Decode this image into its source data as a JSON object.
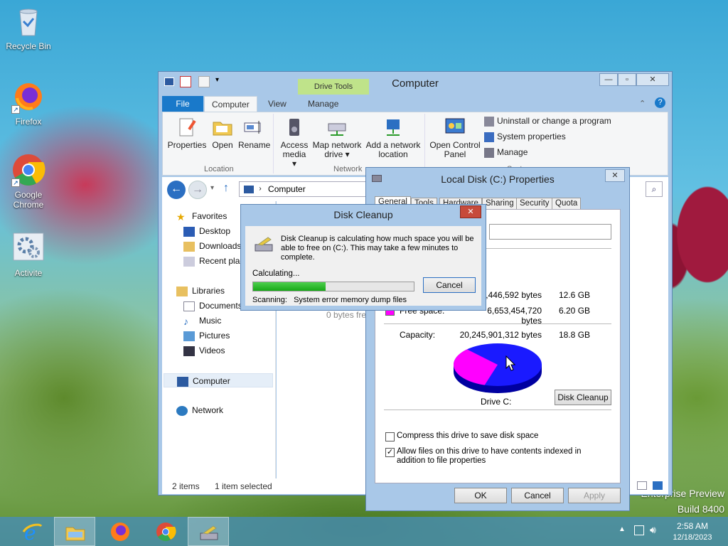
{
  "desktop": {
    "icons": [
      {
        "name": "recycle-bin",
        "label": "Recycle Bin"
      },
      {
        "name": "firefox",
        "label": "Firefox"
      },
      {
        "name": "google-chrome",
        "label": "Google Chrome"
      },
      {
        "name": "activite",
        "label": "Activite"
      }
    ],
    "watermark": {
      "line1": "Enterprise Preview",
      "line2": "Build 8400"
    }
  },
  "explorer": {
    "title": "Computer",
    "contextual_group": "Drive Tools",
    "tabs": [
      "File",
      "Computer",
      "View",
      "Manage"
    ],
    "ribbon": {
      "properties": "Properties",
      "open": "Open",
      "rename": "Rename",
      "access_media": "Access media",
      "map_network_drive": "Map network drive",
      "add_network_location": "Add a network location",
      "open_control_panel": "Open Control Panel",
      "uninstall": "Uninstall or change a program",
      "system_properties": "System properties",
      "manage": "Manage",
      "group_location": "Location",
      "group_network": "Network",
      "group_system": "System"
    },
    "address": "Computer",
    "nav": {
      "favorites": "Favorites",
      "desktop": "Desktop",
      "downloads": "Downloads",
      "recent": "Recent places",
      "libraries": "Libraries",
      "documents": "Documents",
      "music": "Music",
      "pictures": "Pictures",
      "videos": "Videos",
      "computer": "Computer",
      "network": "Network"
    },
    "content_partial": "0 bytes free",
    "status_items": "2 items",
    "status_selected": "1 item selected"
  },
  "props": {
    "title": "Local Disk (C:) Properties",
    "tabs": [
      "General",
      "Tools",
      "Hardware",
      "Sharing",
      "Security",
      "Quota"
    ],
    "used": {
      "bytes": "12,446,592 bytes",
      "size": "12.6 GB"
    },
    "free": {
      "label": "Free space:",
      "bytes": "6,653,454,720 bytes",
      "size": "6.20 GB"
    },
    "capacity": {
      "label": "Capacity:",
      "bytes": "20,245,901,312 bytes",
      "size": "18.8 GB"
    },
    "drive_label": "Drive C:",
    "disk_cleanup": "Disk Cleanup",
    "compress": "Compress this drive to save disk space",
    "index": "Allow files on this drive to have contents indexed in addition to file properties",
    "ok": "OK",
    "cancel": "Cancel",
    "apply": "Apply",
    "pie": {
      "used_fraction": 0.67,
      "used_color": "#1a1aff",
      "free_color": "#ff00ff"
    }
  },
  "cleanup": {
    "title": "Disk Cleanup",
    "message": "Disk Cleanup is calculating how much space you will be able to free on  (C:). This may take a few minutes to complete.",
    "calculating": "Calculating...",
    "cancel": "Cancel",
    "progress": 0.45,
    "scanning": "Scanning:   System error memory dump files"
  },
  "taskbar": {
    "time": "2:58 AM",
    "date": "12/18/2023"
  }
}
